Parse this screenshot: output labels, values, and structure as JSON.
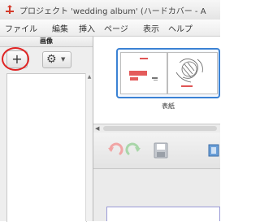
{
  "window": {
    "title": "プロジェクト 'wedding album' (ハードカバー - A"
  },
  "menu": {
    "items": [
      "ファイル",
      "編集",
      "挿入",
      "ページ",
      "表示",
      "ヘルプ"
    ]
  },
  "left_panel": {
    "title": "画像",
    "add_label": "+",
    "gear_icon": "gear-icon",
    "highlight_color": "#e02424"
  },
  "page_strip": {
    "spread_label": "表紙",
    "selection_color": "#3b82d4"
  },
  "toolbar": {
    "icons": [
      "undo-icon",
      "redo-icon",
      "save-icon"
    ]
  }
}
